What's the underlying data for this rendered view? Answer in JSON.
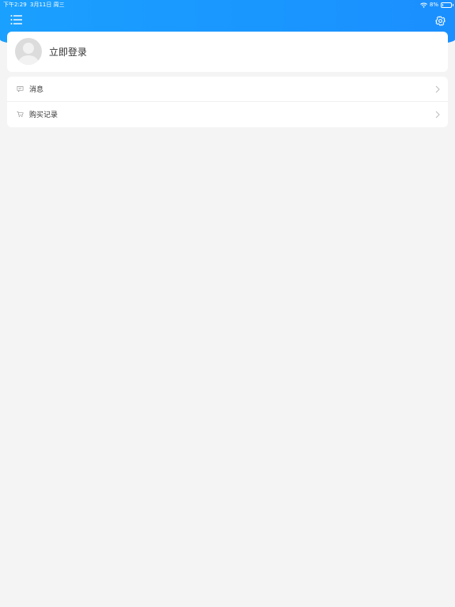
{
  "statusbar": {
    "time": "下午2:29",
    "date": "3月11日 周三",
    "battery_text": "8%",
    "battery_level": 0.08
  },
  "header": {
    "menu_icon": "list-icon",
    "settings_icon": "gear-icon",
    "accent_color": "#1a95ff"
  },
  "profile": {
    "login_label": "立即登录",
    "avatar_icon": "default-avatar-icon"
  },
  "menu": {
    "items": [
      {
        "label": "消息",
        "icon": "message-icon"
      },
      {
        "label": "购买记录",
        "icon": "cart-icon"
      }
    ]
  }
}
